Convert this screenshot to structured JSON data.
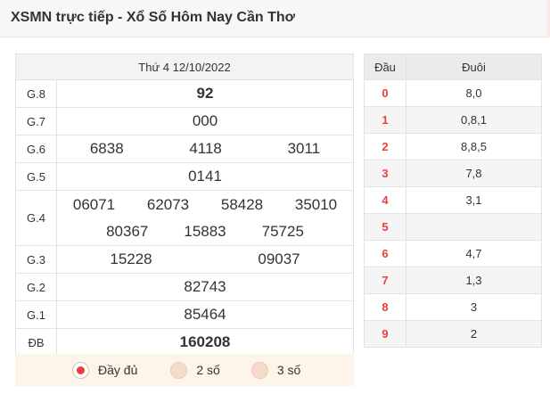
{
  "header": {
    "title": "XSMN trực tiếp - Xổ Số Hôm Nay Cần Thơ"
  },
  "results": {
    "date": "Thứ 4 12/10/2022",
    "prizes": [
      {
        "label": "G.8",
        "numbers": [
          "92"
        ]
      },
      {
        "label": "G.7",
        "numbers": [
          "000"
        ]
      },
      {
        "label": "G.6",
        "numbers": [
          "6838",
          "4118",
          "3011"
        ]
      },
      {
        "label": "G.5",
        "numbers": [
          "0141"
        ]
      },
      {
        "label": "G.4",
        "numbers": [
          "06071",
          "62073",
          "58428",
          "35010",
          "80367",
          "15883",
          "75725"
        ]
      },
      {
        "label": "G.3",
        "numbers": [
          "15228",
          "09037"
        ]
      },
      {
        "label": "G.2",
        "numbers": [
          "82743"
        ]
      },
      {
        "label": "G.1",
        "numbers": [
          "85464"
        ]
      },
      {
        "label": "ĐB",
        "numbers": [
          "160208"
        ]
      }
    ]
  },
  "display_options": {
    "selected": "Đầy đủ",
    "options": [
      "Đầy đủ",
      "2 số",
      "3 số"
    ]
  },
  "loto": {
    "head_label": "Đầu",
    "tail_label": "Đuôi",
    "rows": [
      {
        "head": "0",
        "tail": "8,0"
      },
      {
        "head": "1",
        "tail": "0,8,1"
      },
      {
        "head": "2",
        "tail": "8,8,5"
      },
      {
        "head": "3",
        "tail": "7,8"
      },
      {
        "head": "4",
        "tail": "3,1"
      },
      {
        "head": "5",
        "tail": ""
      },
      {
        "head": "6",
        "tail": "4,7"
      },
      {
        "head": "7",
        "tail": "1,3"
      },
      {
        "head": "8",
        "tail": "3"
      },
      {
        "head": "9",
        "tail": "2"
      }
    ]
  },
  "colors": {
    "accent_red": "#e8403f",
    "radio_bg": "#fdf5ea"
  }
}
